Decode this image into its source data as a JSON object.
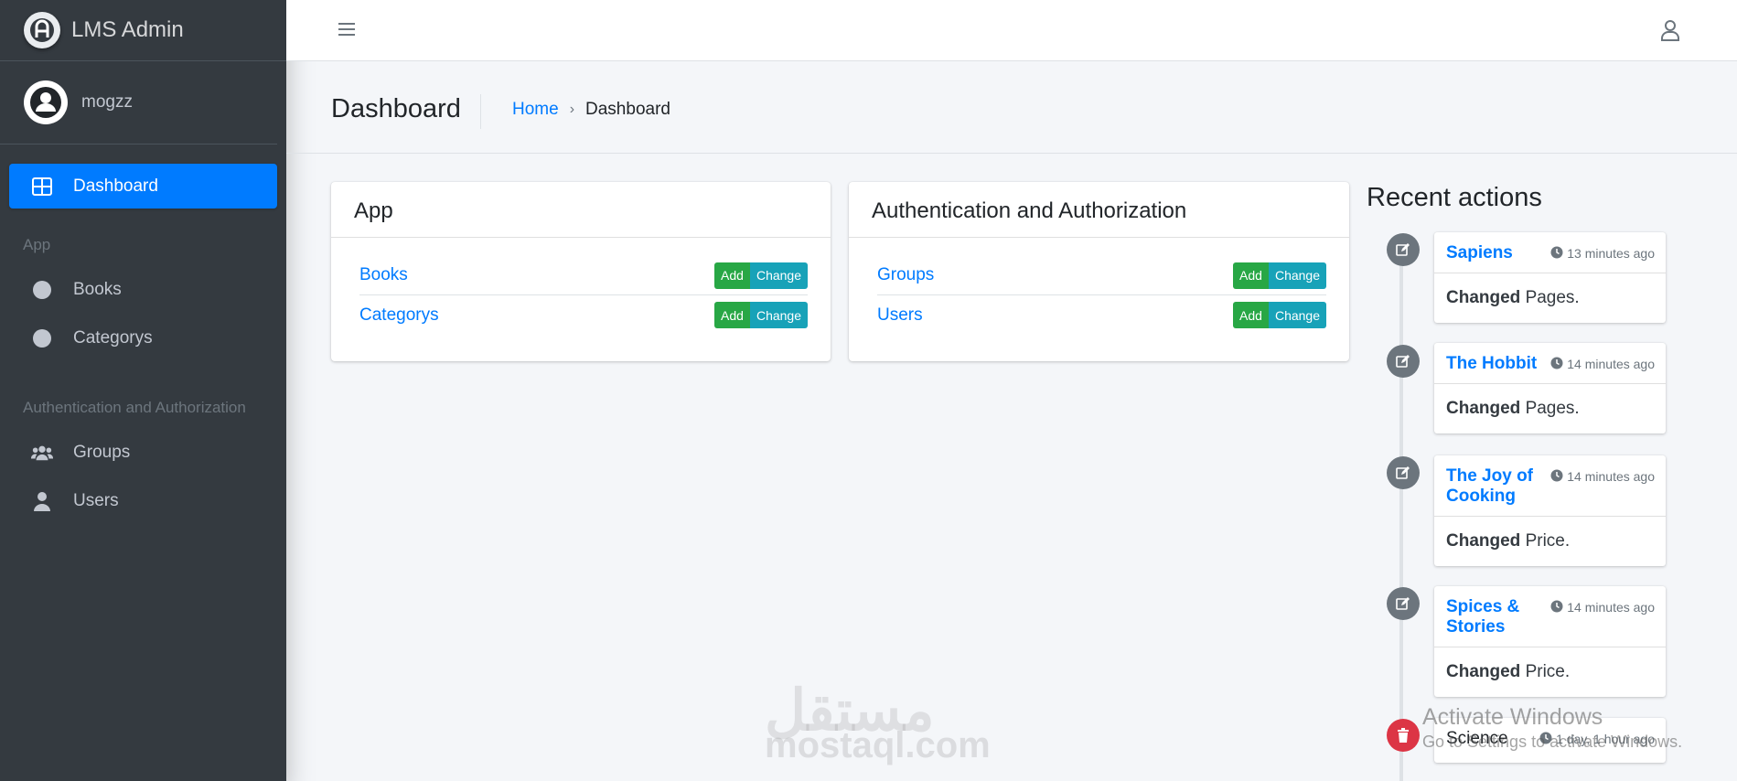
{
  "brand": {
    "title": "LMS Admin"
  },
  "user": {
    "name": "mogzz"
  },
  "sidebar": {
    "dashboard_label": "Dashboard",
    "section_app": "App",
    "books_label": "Books",
    "categorys_label": "Categorys",
    "section_auth": "Authentication and Authorization",
    "groups_label": "Groups",
    "users_label": "Users"
  },
  "header": {
    "page_title": "Dashboard",
    "breadcrumb_home": "Home",
    "breadcrumb_sep": "›",
    "breadcrumb_current": "Dashboard"
  },
  "app_card": {
    "title": "App",
    "rows": [
      {
        "label": "Books",
        "add": "Add",
        "change": "Change"
      },
      {
        "label": "Categorys",
        "add": "Add",
        "change": "Change"
      }
    ]
  },
  "auth_card": {
    "title": "Authentication and Authorization",
    "rows": [
      {
        "label": "Groups",
        "add": "Add",
        "change": "Change"
      },
      {
        "label": "Users",
        "add": "Add",
        "change": "Change"
      }
    ]
  },
  "recent": {
    "title": "Recent actions",
    "items": [
      {
        "title": "Sapiens",
        "time": "13 minutes ago",
        "action": "Changed",
        "detail": "Pages."
      },
      {
        "title": "The Hobbit",
        "time": "14 minutes ago",
        "action": "Changed",
        "detail": "Pages."
      },
      {
        "title": "The Joy of Cooking",
        "time": "14 minutes ago",
        "action": "Changed",
        "detail": "Price."
      },
      {
        "title": "Spices & Stories",
        "time": "14 minutes ago",
        "action": "Changed",
        "detail": "Price."
      },
      {
        "title": "Science",
        "time": "1 day, 1 hour ago"
      }
    ]
  },
  "watermark": {
    "logo": "مستقل",
    "site": "mostaql.com",
    "activate_title": "Activate Windows",
    "activate_sub": "Go to Settings to activate Windows."
  },
  "colors": {
    "primary": "#007bff",
    "sidebar": "#343a40",
    "add": "#28a745",
    "change": "#17a2b8",
    "delete": "#dc3545"
  },
  "icons": {
    "brand": "logo-icon",
    "hamburger": "menu-icon",
    "user": "user-icon",
    "dashboard": "dashboard-icon",
    "circle": "circle-icon",
    "groups": "users-group-icon",
    "users": "user-icon",
    "edit": "edit-icon",
    "delete": "trash-icon",
    "clock": "clock-icon"
  }
}
